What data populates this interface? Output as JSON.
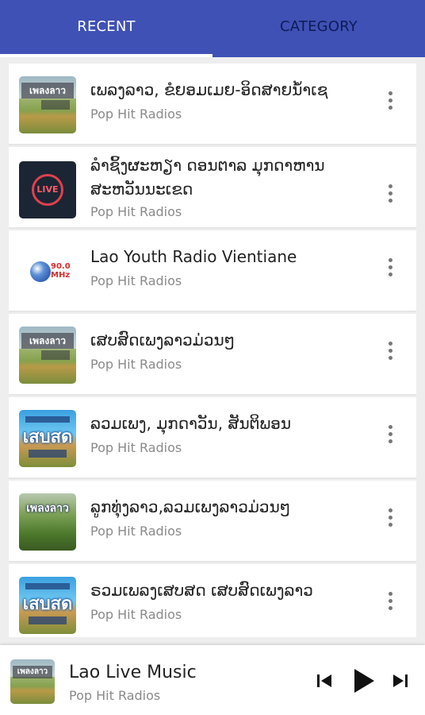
{
  "tabs": [
    {
      "label": "RECENT",
      "active": true
    },
    {
      "label": "CATEGORY",
      "active": false
    }
  ],
  "stations": [
    {
      "title": "ເພລງລາວ, ຂໍຍອມເມຍ-ອິດສາຍນ້ຳເຊ",
      "subtitle": "Pop Hit Radios",
      "thumb": "lao-landscape-thumb",
      "thumb_text": "เพลงลาว"
    },
    {
      "title": "ລຳຊິ້ງຜະຫຽາ ດອນຕາລ ມຸກດາຫານ ສະຫວັນນະເຂດ",
      "subtitle": "Pop Hit Radios",
      "thumb": "live-thumb",
      "thumb_text": "LIVE"
    },
    {
      "title": "Lao Youth Radio Vientiane",
      "subtitle": "Pop Hit Radios",
      "thumb": "youth-radio-thumb",
      "thumb_text": "90.0 MHz"
    },
    {
      "title": "ເສບສົດເພງລາວມ່ວນໆ",
      "subtitle": "Pop Hit Radios",
      "thumb": "lao-landscape-thumb",
      "thumb_text": "เพลงลาว"
    },
    {
      "title": "ລວມເພງ, ມຸກດາວັນ, ສັນຕິພອນ",
      "subtitle": "Pop Hit Radios",
      "thumb": "sabai-thumb",
      "thumb_text": "เสบสด"
    },
    {
      "title": "ລູກທຸ່ງລາວ,ລວມເພງລາວມ່ວນໆ",
      "subtitle": "Pop Hit Radios",
      "thumb": "green-thumb",
      "thumb_text": "เพลงลาว"
    },
    {
      "title": "ຣວມເພລງເສບສດ ເສບສົດເພງລາວ",
      "subtitle": "Pop Hit Radios",
      "thumb": "sabai-thumb",
      "thumb_text": "เสบสด"
    }
  ],
  "player": {
    "title": "Lao Live Music",
    "subtitle": "Pop Hit Radios",
    "thumb_text": "เพลงลาว",
    "controls": [
      "skip-previous-icon",
      "play-icon",
      "skip-next-icon"
    ]
  },
  "colors": {
    "primary": "#3f51b5",
    "inactive_tab_text": "#0d1b57",
    "subtitle": "#8a8a8a",
    "background": "#eeeeee"
  }
}
